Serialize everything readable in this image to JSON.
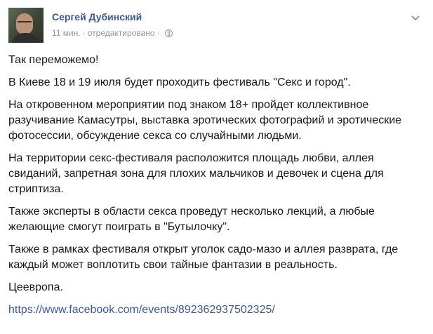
{
  "post": {
    "author": "Сергей Дубинский",
    "time": "11 мин.",
    "separator": "·",
    "edited": "отредактировано",
    "paragraphs": [
      "Так переможемо!",
      "В Киеве 18 и 19 июля будет проходить фестиваль \"Секс и город\".",
      "На откровенном мероприятии под знаком 18+ пройдет коллективное разучивание Камасутры, выставка эротических фотографий и эротические фотосессии, обсуждение секса со случайными людьми.",
      "На территории секс-фестиваля расположится площадь любви, аллея свиданий, запретная зона для плохих мальчиков и девочек и сцена для стриптиза.",
      "Также эксперты в области секса проведут несколько лекций, а любые желающие смогут поиграть в \"Бутылочку\".",
      "Также в рамках фестиваля открыт уголок садо-мазо и аллея разврата, где каждый может воплотить свои тайные фантазии в реальность.",
      "Цеевропа."
    ],
    "link": "https://www.facebook.com/events/892362937502325/"
  },
  "icons": {
    "privacy": "globe-icon",
    "menu": "chevron-down-icon"
  },
  "colors": {
    "link": "#3b5998",
    "meta": "#9197a3",
    "text": "#141823"
  }
}
